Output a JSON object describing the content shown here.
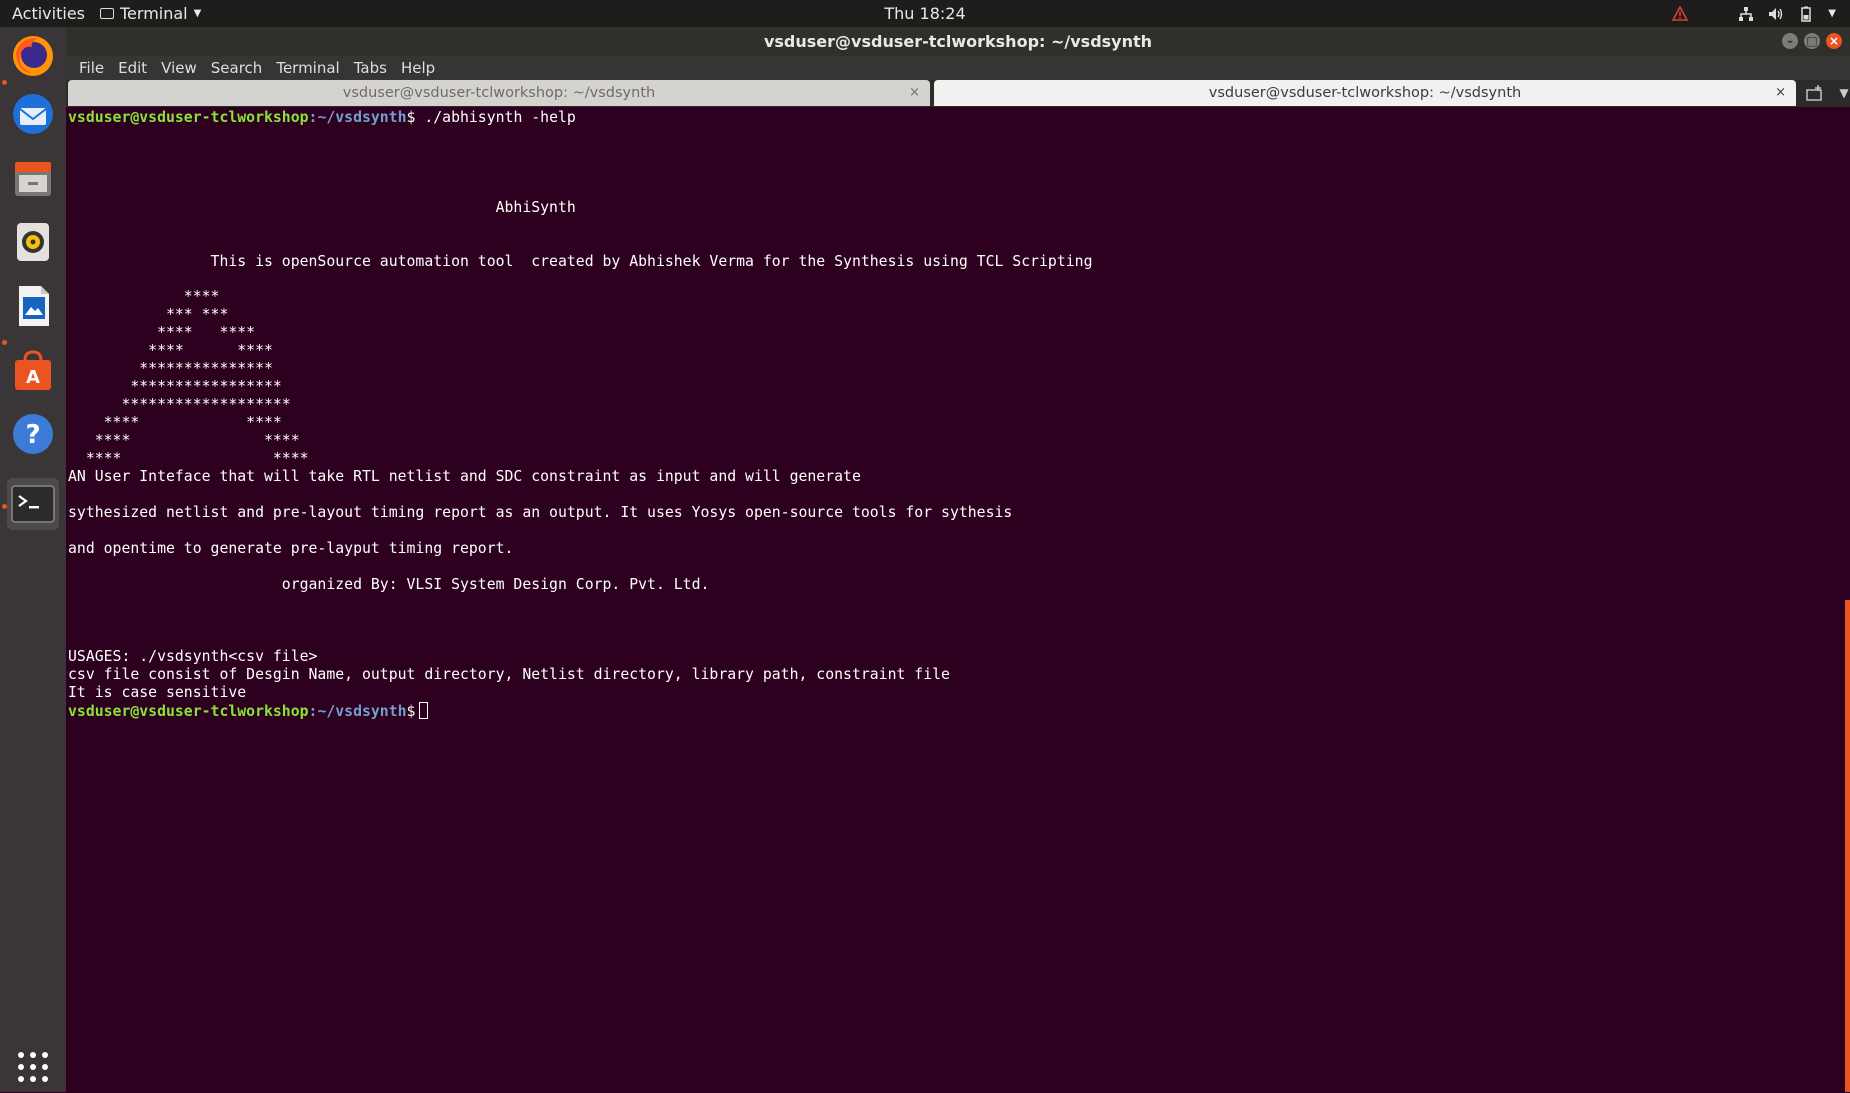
{
  "topbar": {
    "activities": "Activities",
    "app_name": "Terminal",
    "clock": "Thu 18:24",
    "tray_icons": [
      "warning-icon",
      "network-icon",
      "volume-icon",
      "battery-icon",
      "power-menu-icon"
    ]
  },
  "dock": {
    "items": [
      "firefox-icon",
      "thunderbird-icon",
      "files-icon",
      "rhythmbox-icon",
      "libreoffice-writer-icon",
      "software-center-icon",
      "help-icon",
      "terminal-icon"
    ],
    "show_apps_icon": "show-applications-icon"
  },
  "window": {
    "title": "vsduser@vsduser-tclworkshop: ~/vsdsynth",
    "menus": [
      "File",
      "Edit",
      "View",
      "Search",
      "Terminal",
      "Tabs",
      "Help"
    ],
    "tabs": [
      {
        "label": "vsduser@vsduser-tclworkshop: ~/vsdsynth",
        "active": false
      },
      {
        "label": "vsduser@vsduser-tclworkshop: ~/vsdsynth",
        "active": true
      }
    ]
  },
  "terminal": {
    "prompt_user": "vsduser@vsduser-tclworkshop",
    "prompt_path": ":~/vsdsynth",
    "prompt_sign": "$",
    "command": " ./abhisynth -help",
    "lines": [
      "                                                AbhiSynth",
      "                This is openSource automation tool  created by Abhishek Verma for the Synthesis using TCL Scripting",
      "             ****",
      "           *** ***",
      "          ****   ****",
      "         ****      ****",
      "        ***************",
      "       *****************",
      "      *******************",
      "    ****            ****",
      "   ****               ****",
      "  ****                 ****",
      "AN User Inteface that will take RTL netlist and SDC constraint as input and will generate",
      "sythesized netlist and pre-layout timing report as an output. It uses Yosys open-source tools for sythesis",
      "and opentime to generate pre-layput timing report.",
      "                        organized By: VLSI System Design Corp. Pvt. Ltd.",
      "USAGES: ./vsdsynth<csv file>",
      "csv file consist of Desgin Name, output directory, Netlist directory, library path, constraint file",
      "It is case sensitive"
    ]
  },
  "colors": {
    "terminal_bg": "#2c001e",
    "prompt_user": "#8ae234",
    "prompt_path": "#729fcf",
    "accent": "#e95420"
  }
}
